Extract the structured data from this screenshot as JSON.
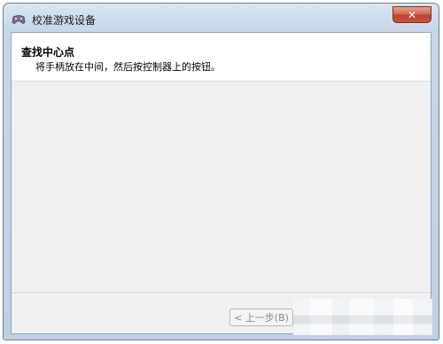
{
  "window": {
    "title": "校准游戏设备",
    "close_glyph": "✕"
  },
  "header": {
    "title": "查找中心点",
    "description": "将手柄放在中间，然后按控制器上的按钮。"
  },
  "buttons": {
    "back_label": "< 上一步(B)"
  },
  "icons": {
    "app": "gamepad-icon",
    "close": "close-icon"
  },
  "colors": {
    "titlebar": "#c7d7e9",
    "client_background": "#f0f0f0",
    "header_background": "#ffffff",
    "close_button": "#c0432d"
  }
}
